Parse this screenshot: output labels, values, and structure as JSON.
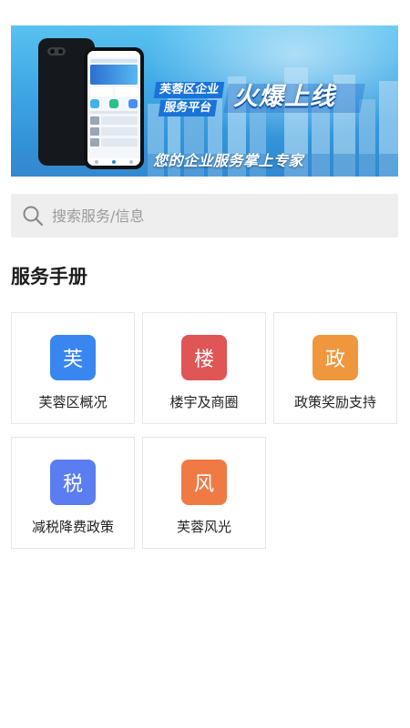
{
  "banner": {
    "line1": "芙蓉区企业",
    "line2": "服务平台",
    "headline": "火爆上线",
    "slogan": "您的企业服务掌上专家"
  },
  "search": {
    "placeholder": "搜索服务/信息"
  },
  "section": {
    "title": "服务手册"
  },
  "services": [
    {
      "icon_char": "芙",
      "label": "芙蓉区概况",
      "color": "#3a86f0"
    },
    {
      "icon_char": "楼",
      "label": "楼宇及商圈",
      "color": "#e05555"
    },
    {
      "icon_char": "政",
      "label": "政策奖励支持",
      "color": "#f0973d"
    },
    {
      "icon_char": "税",
      "label": "减税降费政策",
      "color": "#5a7df2"
    },
    {
      "icon_char": "风",
      "label": "芙蓉风光",
      "color": "#f07a44"
    }
  ],
  "colors": {
    "search_bg": "#eeeeee",
    "card_border": "#e6e6e6",
    "banner_blue": "#1a73d9"
  }
}
